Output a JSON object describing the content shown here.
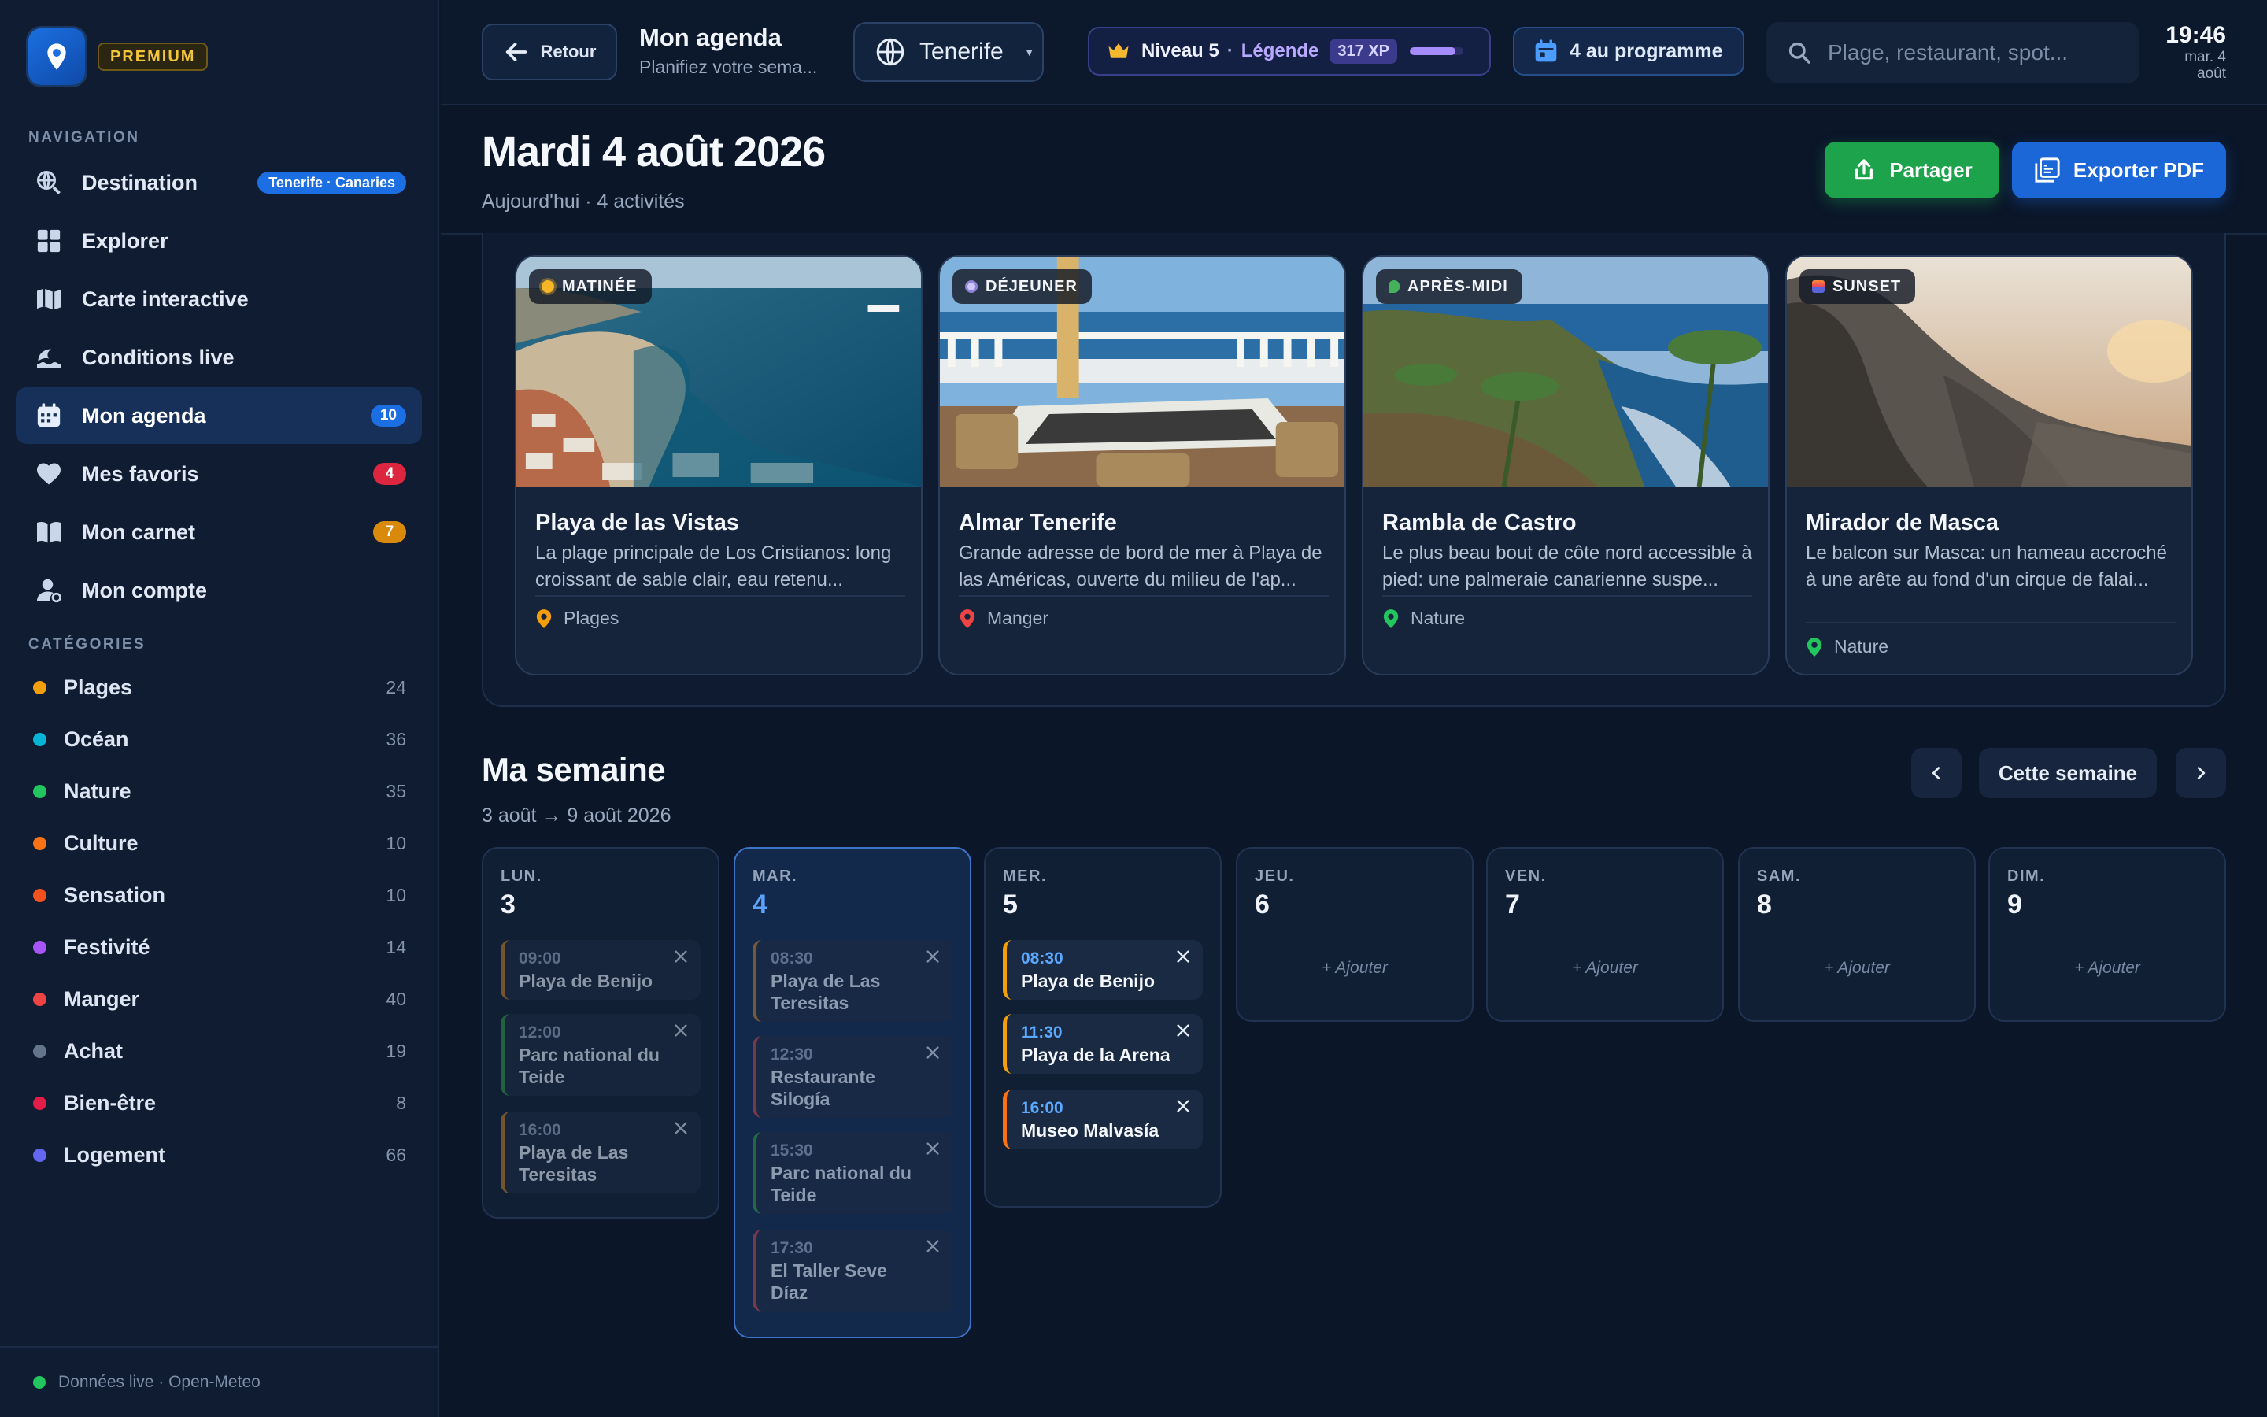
{
  "sidebar": {
    "premium_label": "PREMIUM",
    "nav_section": "NAVIGATION",
    "nav": [
      {
        "label": "Destination",
        "badge": "Tenerife · Canaries",
        "icon": "globe-search-icon"
      },
      {
        "label": "Explorer",
        "badge": "",
        "icon": "grid-icon"
      },
      {
        "label": "Carte interactive",
        "badge": "",
        "icon": "map-icon"
      },
      {
        "label": "Conditions live",
        "badge": "",
        "icon": "wave-icon"
      },
      {
        "label": "Mon agenda",
        "badge": "10",
        "icon": "calendar-icon"
      },
      {
        "label": "Mes favoris",
        "badge": "4",
        "icon": "heart-icon"
      },
      {
        "label": "Mon carnet",
        "badge": "7",
        "icon": "book-icon"
      },
      {
        "label": "Mon compte",
        "badge": "",
        "icon": "account-icon"
      }
    ],
    "categories_section": "CATÉGORIES",
    "categories": [
      {
        "label": "Plages",
        "count": "24",
        "color": "#f59e0b"
      },
      {
        "label": "Océan",
        "count": "36",
        "color": "#06b6d4"
      },
      {
        "label": "Nature",
        "count": "35",
        "color": "#22c55e"
      },
      {
        "label": "Culture",
        "count": "10",
        "color": "#f97316"
      },
      {
        "label": "Sensation",
        "count": "10",
        "color": "#f4511e"
      },
      {
        "label": "Festivité",
        "count": "14",
        "color": "#a855f7"
      },
      {
        "label": "Manger",
        "count": "40",
        "color": "#ef4444"
      },
      {
        "label": "Achat",
        "count": "19",
        "color": "#64748b"
      },
      {
        "label": "Bien-être",
        "count": "8",
        "color": "#e11d48"
      },
      {
        "label": "Logement",
        "count": "66",
        "color": "#6366f1"
      }
    ],
    "footer": "Données live · Open-Meteo"
  },
  "topbar": {
    "back_label": "Retour",
    "title": "Mon agenda",
    "subtitle": "Planifiez votre sema...",
    "destination": "Tenerife",
    "level": "Niveau 5",
    "level_sep": "·",
    "rank": "Légende",
    "xp": "317 XP",
    "xp_progress": 0.85,
    "programme": "4 au programme",
    "search_placeholder": "Plage, restaurant, spot...",
    "time": "19:46",
    "date": "mar. 4 août"
  },
  "header": {
    "title": "Mardi 4 août 2026",
    "subtitle": "Aujourd'hui · 4 activités",
    "share_label": "Partager",
    "export_label": "Exporter PDF"
  },
  "today": [
    {
      "tag": "MATINÉE",
      "tag_icon": "sun-icon",
      "title": "Playa de las Vistas",
      "desc": "La plage principale de Los Cristianos: long croissant de sable clair, eau retenu...",
      "category": "Plages",
      "pin_color": "#f59e0b"
    },
    {
      "tag": "DÉJEUNER",
      "tag_icon": "plate-icon",
      "title": "Almar Tenerife",
      "desc": "Grande adresse de bord de mer à Playa de las Américas, ouverte du milieu de l'ap...",
      "category": "Manger",
      "pin_color": "#ef4444"
    },
    {
      "tag": "APRÈS-MIDI",
      "tag_icon": "leaf-icon",
      "title": "Rambla de Castro",
      "desc": "Le plus beau bout de côte nord accessible à pied: une palmeraie canarienne suspe...",
      "category": "Nature",
      "pin_color": "#22c55e"
    },
    {
      "tag": "SUNSET",
      "tag_icon": "sunset-icon",
      "title": "Mirador de Masca",
      "desc": "Le balcon sur Masca: un hameau accroché à une arête au fond d'un cirque de falai...",
      "category": "Nature",
      "pin_color": "#22c55e"
    }
  ],
  "week": {
    "title": "Ma semaine",
    "range": "3 août → 9 août 2026",
    "this_week": "Cette semaine",
    "add_label": "+ Ajouter",
    "days": [
      {
        "abbr": "LUN.",
        "num": "3",
        "events": [
          {
            "time": "09:00",
            "name": "Playa de Benijo",
            "color": "#b7782a"
          },
          {
            "time": "12:00",
            "name": "Parc national du Teide",
            "color": "#2f8f4a"
          },
          {
            "time": "16:00",
            "name": "Playa de Las Teresitas",
            "color": "#b7782a"
          }
        ]
      },
      {
        "abbr": "MAR.",
        "num": "4",
        "events": [
          {
            "time": "08:30",
            "name": "Playa de Las Teresitas",
            "color": "#b7782a"
          },
          {
            "time": "12:30",
            "name": "Restaurante Silogía",
            "color": "#b8424a"
          },
          {
            "time": "15:30",
            "name": "Parc national du Teide",
            "color": "#2f8f4a"
          },
          {
            "time": "17:30",
            "name": "El Taller Seve Díaz",
            "color": "#b8424a"
          }
        ]
      },
      {
        "abbr": "MER.",
        "num": "5",
        "events": [
          {
            "time": "08:30",
            "name": "Playa de Benijo",
            "color": "#f59e0b"
          },
          {
            "time": "11:30",
            "name": "Playa de la Arena",
            "color": "#f59e0b"
          },
          {
            "time": "16:00",
            "name": "Museo Malvasía",
            "color": "#f97316"
          }
        ]
      },
      {
        "abbr": "JEU.",
        "num": "6",
        "events": []
      },
      {
        "abbr": "VEN.",
        "num": "7",
        "events": []
      },
      {
        "abbr": "SAM.",
        "num": "8",
        "events": []
      },
      {
        "abbr": "DIM.",
        "num": "9",
        "events": []
      }
    ]
  }
}
